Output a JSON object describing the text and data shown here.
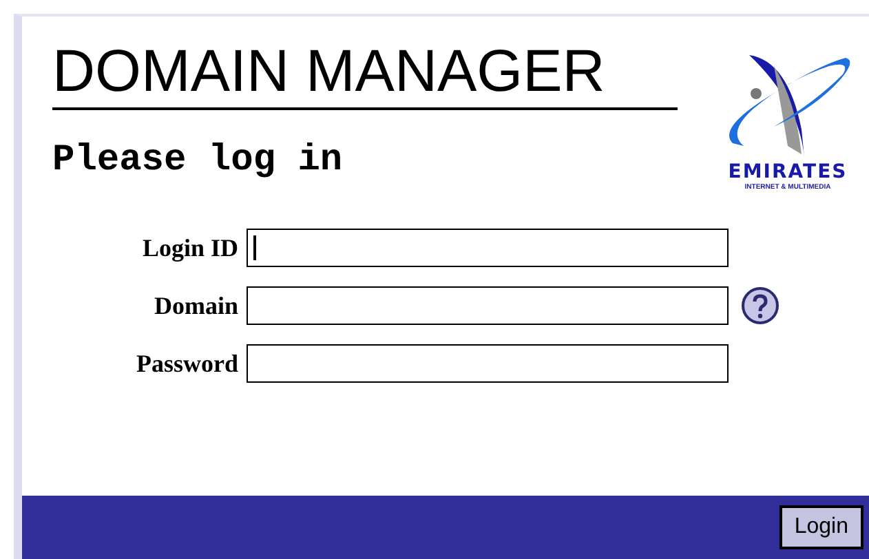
{
  "header": {
    "title": "DOMAIN MANAGER",
    "subtitle": "Please log in"
  },
  "logo": {
    "name": "EMIRATES",
    "tagline": "INTERNET & MULTIMEDIA"
  },
  "fields": [
    {
      "label": "Login ID",
      "focused": true,
      "help": false
    },
    {
      "label": "Domain",
      "focused": false,
      "help": true
    },
    {
      "label": "Password",
      "focused": false,
      "help": false
    }
  ],
  "footer": {
    "button": "Login"
  }
}
